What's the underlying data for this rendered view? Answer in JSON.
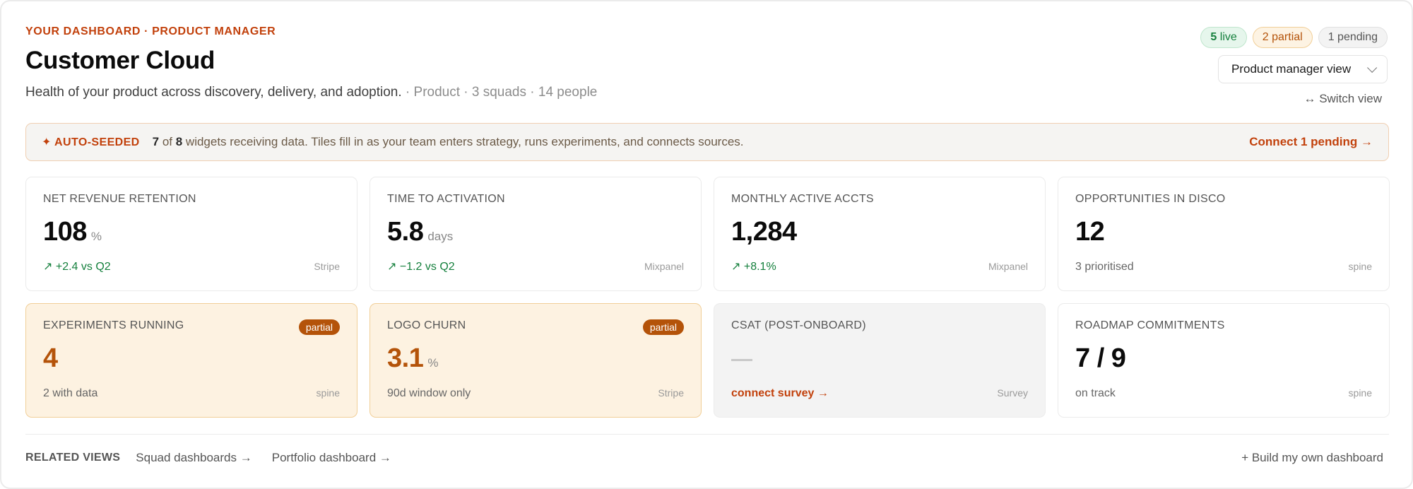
{
  "header": {
    "eyebrow": "YOUR DASHBOARD · PRODUCT MANAGER",
    "title": "Customer Cloud",
    "subtitle": "Health of your product across discovery, delivery, and adoption.",
    "meta": " · Product · 3 squads · 14 people"
  },
  "badges": {
    "live_count": "5",
    "live_label": " live",
    "partial": "2 partial",
    "pending": "1 pending"
  },
  "view_select": {
    "value": "Product manager view"
  },
  "switch_view": "↔ Switch view",
  "banner": {
    "tag": "✦ AUTO-SEEDED",
    "count": "7",
    "of": " of ",
    "total": "8",
    "message": " widgets receiving data. Tiles fill in as your team enters strategy, runs experiments, and connects sources.",
    "cta": "Connect 1 pending →"
  },
  "tiles": [
    {
      "label": "NET REVENUE RETENTION",
      "value": "108",
      "unit": "%",
      "sub": "↗ +2.4 vs Q2",
      "source": "Stripe"
    },
    {
      "label": "TIME TO ACTIVATION",
      "value": "5.8",
      "unit": "days",
      "sub": "↗ −1.2 vs Q2",
      "source": "Mixpanel"
    },
    {
      "label": "MONTHLY ACTIVE ACCTS",
      "value": "1,284",
      "unit": "",
      "sub": "↗ +8.1%",
      "source": "Mixpanel"
    },
    {
      "label": "OPPORTUNITIES IN DISCO",
      "value": "12",
      "unit": "",
      "sub": "3 prioritised",
      "source": "spine"
    },
    {
      "label": "EXPERIMENTS RUNNING",
      "value": "4",
      "unit": "",
      "sub": "2 with data",
      "source": "spine",
      "status": "partial"
    },
    {
      "label": "LOGO CHURN",
      "value": "3.1",
      "unit": "%",
      "sub": "90d window only",
      "source": "Stripe",
      "status": "partial"
    },
    {
      "label": "CSAT (POST-ONBOARD)",
      "value": "",
      "unit": "",
      "sub": "connect survey →",
      "source": "Survey"
    },
    {
      "label": "ROADMAP COMMITMENTS",
      "value": "7 / 9",
      "unit": "",
      "sub": "on track",
      "source": "spine"
    }
  ],
  "footer": {
    "related_label": "RELATED VIEWS",
    "links": [
      "Squad dashboards →",
      "Portfolio dashboard →"
    ],
    "build": "+ Build my own dashboard"
  },
  "colors": {
    "accent": "#c2410c",
    "positive": "#15803d",
    "partial": "#b45309"
  }
}
